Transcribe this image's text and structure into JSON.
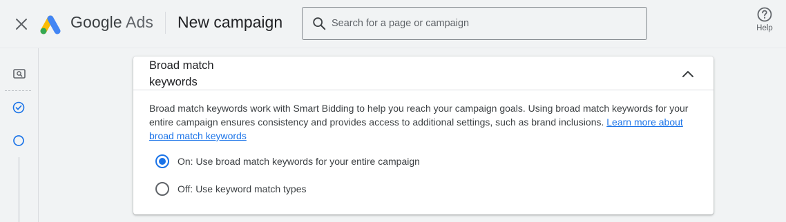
{
  "header": {
    "brand_google": "Google",
    "brand_ads": "Ads",
    "page_title": "New campaign",
    "search_placeholder": "Search for a page or campaign",
    "help_label": "Help"
  },
  "icons": {
    "close": "close-icon",
    "logo": "google-ads-logo",
    "search": "search-icon",
    "help": "help-circle-icon",
    "rail": [
      "search-preview-icon",
      "check-circle-icon",
      "empty-circle-icon"
    ],
    "collapse": "chevron-up-icon"
  },
  "card": {
    "title": "Broad match keywords",
    "description": "Broad match keywords work with Smart Bidding to help you reach your campaign goals. Using broad match keywords for your entire campaign ensures consistency and provides access to additional settings, such as brand inclusions. ",
    "link_text": "Learn more about broad match keywords",
    "options": [
      {
        "label": "On: Use broad match keywords for your entire campaign",
        "selected": true
      },
      {
        "label": "Off: Use keyword match types",
        "selected": false
      }
    ]
  },
  "colors": {
    "accent": "#1a73e8",
    "background": "#f1f3f4",
    "card": "#ffffff",
    "logo_yellow": "#fbbc04",
    "logo_blue": "#4285f4",
    "logo_green": "#34a853"
  }
}
